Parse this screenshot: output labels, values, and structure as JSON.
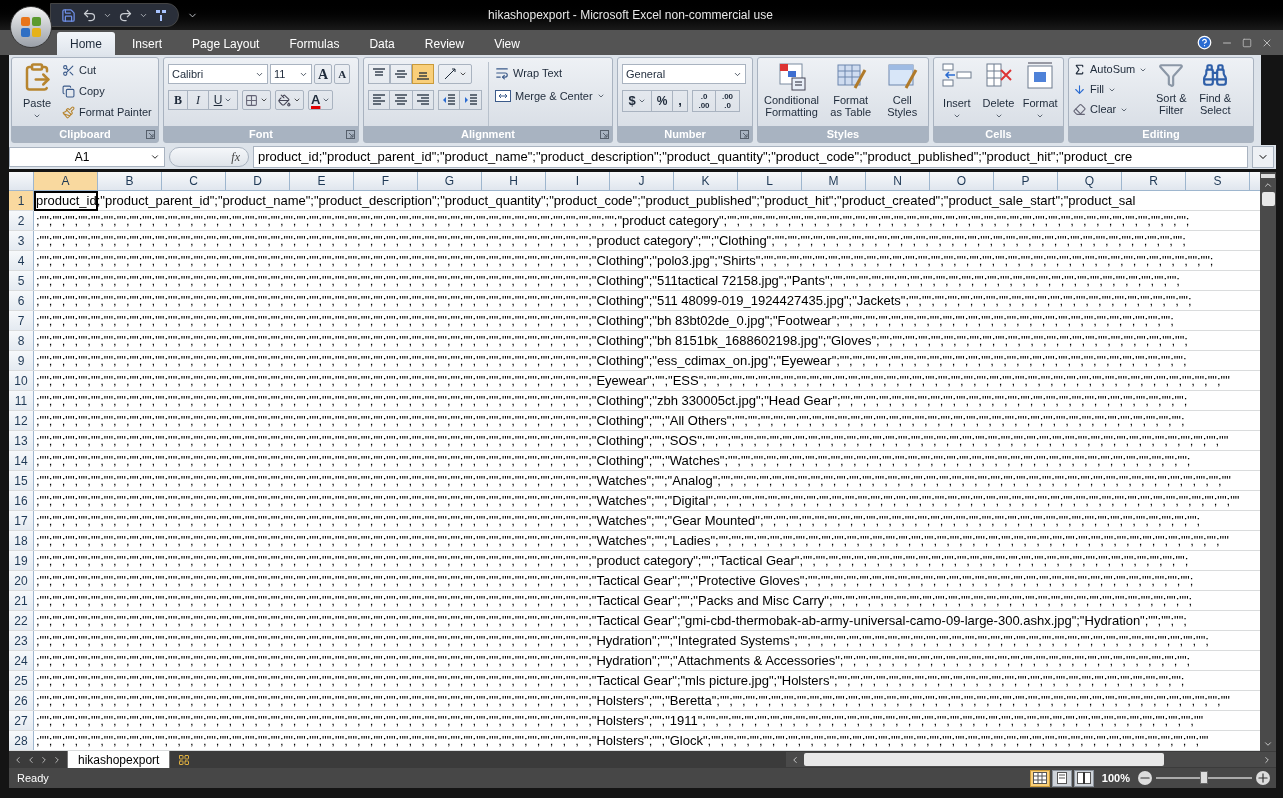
{
  "window": {
    "title": "hikashopexport - Microsoft Excel non-commercial use"
  },
  "tabs": [
    {
      "label": "Home",
      "selected": true
    },
    {
      "label": "Insert",
      "selected": false
    },
    {
      "label": "Page Layout",
      "selected": false
    },
    {
      "label": "Formulas",
      "selected": false
    },
    {
      "label": "Data",
      "selected": false
    },
    {
      "label": "Review",
      "selected": false
    },
    {
      "label": "View",
      "selected": false
    }
  ],
  "ribbon": {
    "clipboard": {
      "label": "Clipboard",
      "paste": "Paste",
      "cut": "Cut",
      "copy": "Copy",
      "format_painter": "Format Painter"
    },
    "font": {
      "label": "Font",
      "font_name": "Calibri",
      "font_size": "11",
      "grow": "A",
      "shrink": "A",
      "bold": "B",
      "italic": "I",
      "underline": "U",
      "font_color": "A"
    },
    "alignment": {
      "label": "Alignment",
      "vertical_align": [
        {
          "kind": "top",
          "selected": false
        },
        {
          "kind": "middle",
          "selected": false
        },
        {
          "kind": "bottom",
          "selected": true
        }
      ],
      "wrap_text": "Wrap Text",
      "merge_center": "Merge & Center"
    },
    "number": {
      "label": "Number",
      "format": "General",
      "currency": "$",
      "percent": "%",
      "comma": ",",
      "increase_decimal": [
        ".0",
        ".00"
      ],
      "decrease_decimal": [
        ".00",
        ".0"
      ]
    },
    "styles": {
      "label": "Styles",
      "items": [
        {
          "kind": "conditional",
          "label": "Conditional Formatting"
        },
        {
          "kind": "table",
          "label": "Format as Table"
        },
        {
          "kind": "cell",
          "label": "Cell Styles"
        }
      ]
    },
    "cells": {
      "label": "Cells",
      "items": [
        {
          "kind": "insert",
          "label": "Insert"
        },
        {
          "kind": "delete",
          "label": "Delete"
        },
        {
          "kind": "format",
          "label": "Format"
        }
      ]
    },
    "editing": {
      "label": "Editing",
      "autosum": "AutoSum",
      "fill": "Fill",
      "clear": "Clear",
      "sort_filter": "Sort & Filter",
      "find_select": "Find & Select"
    }
  },
  "formula_bar": {
    "name_box": "A1",
    "fx": "fx",
    "formula": "product_id;\"product_parent_id\";\"product_name\";\"product_description\";\"product_quantity\";\"product_code\";\"product_published\";\"product_hit\";\"product_cre"
  },
  "sheet": {
    "columns": [
      {
        "label": "A",
        "selected": true
      },
      {
        "label": "B",
        "selected": false
      },
      {
        "label": "C",
        "selected": false
      },
      {
        "label": "D",
        "selected": false
      },
      {
        "label": "E",
        "selected": false
      },
      {
        "label": "F",
        "selected": false
      },
      {
        "label": "G",
        "selected": false
      },
      {
        "label": "H",
        "selected": false
      },
      {
        "label": "I",
        "selected": false
      },
      {
        "label": "J",
        "selected": false
      },
      {
        "label": "K",
        "selected": false
      },
      {
        "label": "L",
        "selected": false
      },
      {
        "label": "M",
        "selected": false
      },
      {
        "label": "N",
        "selected": false
      },
      {
        "label": "O",
        "selected": false
      },
      {
        "label": "P",
        "selected": false
      },
      {
        "label": "Q",
        "selected": false
      },
      {
        "label": "R",
        "selected": false
      },
      {
        "label": "S",
        "selected": false
      }
    ],
    "rows": [
      {
        "number": "1",
        "selected": true,
        "text": "product_id;\"product_parent_id\";\"product_name\";\"product_description\";\"product_quantity\";\"product_code\";\"product_published\";\"product_hit\";\"product_created\";\"product_sale_start\";\"product_sal"
      },
      {
        "number": "2",
        "selected": false,
        "text": ";\"\";\"\";\"\";\"\";\"\";\"\";\"\";\"\";\"\";\"\";\"\";\"\";\"\";\"\";\"\";\"\";\"\";\"\";\"\";\"\";\"\";\"\";\"\";\"\";\"\";\"\";\"\";\"\";\"\";\"\";\"\";\"\";\"\";\"\";\"\";\"\";\"\";\"\";\"\";\"\";\"\";\"\";\"\";\"\";\"\";\"product category\";\"\";\"\";\"\";\"\";\"\";\"\";\"\";\"\";\"\";\"\";\"\";\"\";\"\";\"\";\"\";\"\";\"\";\"\";\"\";\"\";\"\";\"\";\"\";\"\";\"\";\"\";\"\";\"\";\"\";\"\";\"\";\"\";\"\";\"\";\"\";\"\";"
      },
      {
        "number": "3",
        "selected": false,
        "text": ";\"\";\"\";\"\";\"\";\"\";\"\";\"\";\"\";\"\";\"\";\"\";\"\";\"\";\"\";\"\";\"\";\"\";\"\";\"\";\"\";\"\";\"\";\"\";\"\";\"\";\"\";\"\";\"\";\"\";\"\";\"\";\"\";\"\";\"\";\"\";\"\";\"\";\"\";\"\";\"\";\"\";\"\";\"\";\"product category\";\"\";\"Clothing\";\"\";\"\";\"\";\"\";\"\";\"\";\"\";\"\";\"\";\"\";\"\";\"\";\"\";\"\";\"\";\"\";\"\";\"\";\"\";\"\";\"\";\"\";\"\";\"\";\"\";\"\";\"\";\"\";\"\";\"\";\"\";\"\";"
      },
      {
        "number": "4",
        "selected": false,
        "text": ";\"\";\"\";\"\";\"\";\"\";\"\";\"\";\"\";\"\";\"\";\"\";\"\";\"\";\"\";\"\";\"\";\"\";\"\";\"\";\"\";\"\";\"\";\"\";\"\";\"\";\"\";\"\";\"\";\"\";\"\";\"\";\"\";\"\";\"\";\"\";\"\";\"\";\"\";\"\";\"\";\"\";\"\";\"\";\"Clothing\";\"polo3.jpg\";\"Shirts\";\"\";\"\";\"\";\"\";\"\";\"\";\"\";\"\";\"\";\"\";\"\";\"\";\"\";\"\";\"\";\"\";\"\";\"\";\"\";\"\";\"\";\"\";\"\";\"\";\"\";\"\";\"\";\"\";\"\";\"\";\"\";\"\";\"\";\"\";\"\";"
      },
      {
        "number": "5",
        "selected": false,
        "text": ";\"\";\"\";\"\";\"\";\"\";\"\";\"\";\"\";\"\";\"\";\"\";\"\";\"\";\"\";\"\";\"\";\"\";\"\";\"\";\"\";\"\";\"\";\"\";\"\";\"\";\"\";\"\";\"\";\"\";\"\";\"\";\"\";\"\";\"\";\"\";\"\";\"\";\"\";\"\";\"\";\"\";\"\";\"\";\"Clothing\";\"511tactical 72158.jpg\";\"Pants\";\"\";\"\";\"\";\"\";\"\";\"\";\"\";\"\";\"\";\"\";\"\";\"\";\"\";\"\";\"\";\"\";\"\";\"\";\"\";\"\";\"\";\"\";\"\";\"\";\"\";\"\";\"\";"
      },
      {
        "number": "6",
        "selected": false,
        "text": ";\"\";\"\";\"\";\"\";\"\";\"\";\"\";\"\";\"\";\"\";\"\";\"\";\"\";\"\";\"\";\"\";\"\";\"\";\"\";\"\";\"\";\"\";\"\";\"\";\"\";\"\";\"\";\"\";\"\";\"\";\"\";\"\";\"\";\"\";\"\";\"\";\"\";\"\";\"\";\"\";\"\";\"\";\"\";\"Clothing\";\"511 48099-019_1924427435.jpg\";\"Jackets\";\"\";\"\";\"\";\"\";\"\";\"\";\"\";\"\";\"\";\"\";\"\";\"\";\"\";\"\";\"\";\"\";\"\";\"\";\"\";\"\";\"\";\"\";"
      },
      {
        "number": "7",
        "selected": false,
        "text": ";\"\";\"\";\"\";\"\";\"\";\"\";\"\";\"\";\"\";\"\";\"\";\"\";\"\";\"\";\"\";\"\";\"\";\"\";\"\";\"\";\"\";\"\";\"\";\"\";\"\";\"\";\"\";\"\";\"\";\"\";\"\";\"\";\"\";\"\";\"\";\"\";\"\";\"\";\"\";\"\";\"\";\"\";\"\";\"Clothing\";\"bh 83bt02de_0.jpg\";\"Footwear\";\"\";\"\";\"\";\"\";\"\";\"\";\"\";\"\";\"\";\"\";\"\";\"\";\"\";\"\";\"\";\"\";\"\";\"\";\"\";\"\";\"\";\"\";\"\";\"\";\"\";\"\";"
      },
      {
        "number": "8",
        "selected": false,
        "text": ";\"\";\"\";\"\";\"\";\"\";\"\";\"\";\"\";\"\";\"\";\"\";\"\";\"\";\"\";\"\";\"\";\"\";\"\";\"\";\"\";\"\";\"\";\"\";\"\";\"\";\"\";\"\";\"\";\"\";\"\";\"\";\"\";\"\";\"\";\"\";\"\";\"\";\"\";\"\";\"\";\"\";\"\";\"\";\"Clothing\";\"bh 8151bk_1688602198.jpg\";\"Gloves\";\"\";\"\";\"\";\"\";\"\";\"\";\"\";\"\";\"\";\"\";\"\";\"\";\"\";\"\";\"\";\"\";\"\";\"\";\"\";\"\";\"\";\"\";\"\";\"\";"
      },
      {
        "number": "9",
        "selected": false,
        "text": ";\"\";\"\";\"\";\"\";\"\";\"\";\"\";\"\";\"\";\"\";\"\";\"\";\"\";\"\";\"\";\"\";\"\";\"\";\"\";\"\";\"\";\"\";\"\";\"\";\"\";\"\";\"\";\"\";\"\";\"\";\"\";\"\";\"\";\"\";\"\";\"\";\"\";\"\";\"\";\"\";\"\";\"\";\"\";\"Clothing\";\"ess_cdimax_on.jpg\";\"Eyewear\";\"\";\"\";\"\";\"\";\"\";\"\";\"\";\"\";\"\";\"\";\"\";\"\";\"\";\"\";\"\";\"\";\"\";\"\";\"\";\"\";\"\";\"\";\"\";\"\";\"\";\"\";\"\";"
      },
      {
        "number": "10",
        "selected": false,
        "text": ";\"\";\"\";\"\";\"\";\"\";\"\";\"\";\"\";\"\";\"\";\"\";\"\";\"\";\"\";\"\";\"\";\"\";\"\";\"\";\"\";\"\";\"\";\"\";\"\";\"\";\"\";\"\";\"\";\"\";\"\";\"\";\"\";\"\";\"\";\"\";\"\";\"\";\"\";\"\";\"\";\"\";\"\";\"\";\"Eyewear\";\"\";\"ESS\";\"\";\"\";\"\";\"\";\"\";\"\";\"\";\"\";\"\";\"\";\"\";\"\";\"\";\"\";\"\";\"\";\"\";\"\";\"\";\"\";\"\";\"\";\"\";\"\";\"\";\"\";\"\";\"\";\"\";\"\";\"\";\"\";\"\";\"\";\"\";\"\";\"\";\"\";\"\";\"\";\"\""
      },
      {
        "number": "11",
        "selected": false,
        "text": ";\"\";\"\";\"\";\"\";\"\";\"\";\"\";\"\";\"\";\"\";\"\";\"\";\"\";\"\";\"\";\"\";\"\";\"\";\"\";\"\";\"\";\"\";\"\";\"\";\"\";\"\";\"\";\"\";\"\";\"\";\"\";\"\";\"\";\"\";\"\";\"\";\"\";\"\";\"\";\"\";\"\";\"\";\"\";\"Clothing\";\"zbh 330005ct.jpg\";\"Head Gear\";\"\";\"\";\"\";\"\";\"\";\"\";\"\";\"\";\"\";\"\";\"\";\"\";\"\";\"\";\"\";\"\";\"\";\"\";\"\";\"\";\"\";\"\";\"\";\"\";\"\";\"\";\"\";"
      },
      {
        "number": "12",
        "selected": false,
        "text": ";\"\";\"\";\"\";\"\";\"\";\"\";\"\";\"\";\"\";\"\";\"\";\"\";\"\";\"\";\"\";\"\";\"\";\"\";\"\";\"\";\"\";\"\";\"\";\"\";\"\";\"\";\"\";\"\";\"\";\"\";\"\";\"\";\"\";\"\";\"\";\"\";\"\";\"\";\"\";\"\";\"\";\"\";\"\";\"Clothing\";\"\";\"All Others\";\"\";\"\";\"\";\"\";\"\";\"\";\"\";\"\";\"\";\"\";\"\";\"\";\"\";\"\";\"\";\"\";\"\";\"\";\"\";\"\";\"\";\"\";\"\";\"\";\"\";\"\";\"\";\"\";\"\";\"\";\"\";\"\";\"\";\"\";\"\";"
      },
      {
        "number": "13",
        "selected": false,
        "text": ";\"\";\"\";\"\";\"\";\"\";\"\";\"\";\"\";\"\";\"\";\"\";\"\";\"\";\"\";\"\";\"\";\"\";\"\";\"\";\"\";\"\";\"\";\"\";\"\";\"\";\"\";\"\";\"\";\"\";\"\";\"\";\"\";\"\";\"\";\"\";\"\";\"\";\"\";\"\";\"\";\"\";\"\";\"\";\"Clothing\";\"\";\"SOS\";\"\";\"\";\"\";\"\";\"\";\"\";\"\";\"\";\"\";\"\";\"\";\"\";\"\";\"\";\"\";\"\";\"\";\"\";\"\";\"\";\"\";\"\";\"\";\"\";\"\";\"\";\"\";\"\";\"\";\"\";\"\";\"\";\"\";\"\";\"\";\"\";\"\";\"\";\"\";\"\";\"\""
      },
      {
        "number": "14",
        "selected": false,
        "text": ";\"\";\"\";\"\";\"\";\"\";\"\";\"\";\"\";\"\";\"\";\"\";\"\";\"\";\"\";\"\";\"\";\"\";\"\";\"\";\"\";\"\";\"\";\"\";\"\";\"\";\"\";\"\";\"\";\"\";\"\";\"\";\"\";\"\";\"\";\"\";\"\";\"\";\"\";\"\";\"\";\"\";\"\";\"\";\"Clothing\";\"\";\"Watches\";\"\";\"\";\"\";\"\";\"\";\"\";\"\";\"\";\"\";\"\";\"\";\"\";\"\";\"\";\"\";\"\";\"\";\"\";\"\";\"\";\"\";\"\";\"\";\"\";\"\";\"\";\"\";\"\";\"\";\"\";\"\";\"\";\"\";\"\";\"\";\"\";"
      },
      {
        "number": "15",
        "selected": false,
        "text": ";\"\";\"\";\"\";\"\";\"\";\"\";\"\";\"\";\"\";\"\";\"\";\"\";\"\";\"\";\"\";\"\";\"\";\"\";\"\";\"\";\"\";\"\";\"\";\"\";\"\";\"\";\"\";\"\";\"\";\"\";\"\";\"\";\"\";\"\";\"\";\"\";\"\";\"\";\"\";\"\";\"\";\"\";\"\";\"Watches\";\"\";\"Analog\";\"\";\"\";\"\";\"\";\"\";\"\";\"\";\"\";\"\";\"\";\"\";\"\";\"\";\"\";\"\";\"\";\"\";\"\";\"\";\"\";\"\";\"\";\"\";\"\";\"\";\"\";\"\";\"\";\"\";\"\";\"\";\"\";\"\";\"\";\"\";\"\";\"\";\"\";\"\";\"\""
      },
      {
        "number": "16",
        "selected": false,
        "text": ";\"\";\"\";\"\";\"\";\"\";\"\";\"\";\"\";\"\";\"\";\"\";\"\";\"\";\"\";\"\";\"\";\"\";\"\";\"\";\"\";\"\";\"\";\"\";\"\";\"\";\"\";\"\";\"\";\"\";\"\";\"\";\"\";\"\";\"\";\"\";\"\";\"\";\"\";\"\";\"\";\"\";\"\";\"\";\"Watches\";\"\";\"Digital\";\"\";\"\";\"\";\"\";\"\";\"\";\"\";\"\";\"\";\"\";\"\";\"\";\"\";\"\";\"\";\"\";\"\";\"\";\"\";\"\";\"\";\"\";\"\";\"\";\"\";\"\";\"\";\"\";\"\";\"\";\"\";\"\";\"\";\"\";\"\";\"\";\"\";\"\";\"\";\"\";\"\""
      },
      {
        "number": "17",
        "selected": false,
        "text": ";\"\";\"\";\"\";\"\";\"\";\"\";\"\";\"\";\"\";\"\";\"\";\"\";\"\";\"\";\"\";\"\";\"\";\"\";\"\";\"\";\"\";\"\";\"\";\"\";\"\";\"\";\"\";\"\";\"\";\"\";\"\";\"\";\"\";\"\";\"\";\"\";\"\";\"\";\"\";\"\";\"\";\"\";\"\";\"Watches\";\"\";\"Gear Mounted\";\"\";\"\";\"\";\"\";\"\";\"\";\"\";\"\";\"\";\"\";\"\";\"\";\"\";\"\";\"\";\"\";\"\";\"\";\"\";\"\";\"\";\"\";\"\";\"\";\"\";\"\";\"\";\"\";\"\";\"\";\"\";\"\";\"\";\"\";"
      },
      {
        "number": "18",
        "selected": false,
        "text": ";\"\";\"\";\"\";\"\";\"\";\"\";\"\";\"\";\"\";\"\";\"\";\"\";\"\";\"\";\"\";\"\";\"\";\"\";\"\";\"\";\"\";\"\";\"\";\"\";\"\";\"\";\"\";\"\";\"\";\"\";\"\";\"\";\"\";\"\";\"\";\"\";\"\";\"\";\"\";\"\";\"\";\"\";\"\";\"Watches\";\"\";\"Ladies\";\"\";\"\";\"\";\"\";\"\";\"\";\"\";\"\";\"\";\"\";\"\";\"\";\"\";\"\";\"\";\"\";\"\";\"\";\"\";\"\";\"\";\"\";\"\";\"\";\"\";\"\";\"\";\"\";\"\";\"\";\"\";\"\";\"\";\"\";\"\";\"\";\"\";\"\";\"\";\"\""
      },
      {
        "number": "19",
        "selected": false,
        "text": ";\"\";\"\";\"\";\"\";\"\";\"\";\"\";\"\";\"\";\"\";\"\";\"\";\"\";\"\";\"\";\"\";\"\";\"\";\"\";\"\";\"\";\"\";\"\";\"\";\"\";\"\";\"\";\"\";\"\";\"\";\"\";\"\";\"\";\"\";\"\";\"\";\"\";\"\";\"\";\"\";\"\";\"\";\"\";\"product category\";\"\";\"Tactical Gear\";\"\";\"\";\"\";\"\";\"\";\"\";\"\";\"\";\"\";\"\";\"\";\"\";\"\";\"\";\"\";\"\";\"\";\"\";\"\";\"\";\"\";\"\";\"\";\"\";\"\";\"\";\"\";\"\";\"\";\"\";"
      },
      {
        "number": "20",
        "selected": false,
        "text": ";\"\";\"\";\"\";\"\";\"\";\"\";\"\";\"\";\"\";\"\";\"\";\"\";\"\";\"\";\"\";\"\";\"\";\"\";\"\";\"\";\"\";\"\";\"\";\"\";\"\";\"\";\"\";\"\";\"\";\"\";\"\";\"\";\"\";\"\";\"\";\"\";\"\";\"\";\"\";\"\";\"\";\"\";\"\";\"Tactical Gear\";\"\";\"Protective Gloves\";\"\";\"\";\"\";\"\";\"\";\"\";\"\";\"\";\"\";\"\";\"\";\"\";\"\";\"\";\"\";\"\";\"\";\"\";\"\";\"\";\"\";\"\";\"\";\"\";\"\";\"\";\"\";\"\";\"\";\"\";"
      },
      {
        "number": "21",
        "selected": false,
        "text": ";\"\";\"\";\"\";\"\";\"\";\"\";\"\";\"\";\"\";\"\";\"\";\"\";\"\";\"\";\"\";\"\";\"\";\"\";\"\";\"\";\"\";\"\";\"\";\"\";\"\";\"\";\"\";\"\";\"\";\"\";\"\";\"\";\"\";\"\";\"\";\"\";\"\";\"\";\"\";\"\";\"\";\"\";\"\";\"Tactical Gear\";\"\";\"Packs and Misc Carry\";\"\";\"\";\"\";\"\";\"\";\"\";\"\";\"\";\"\";\"\";\"\";\"\";\"\";\"\";\"\";\"\";\"\";\"\";\"\";\"\";\"\";\"\";\"\";\"\";\"\";\"\";\"\";\"\";"
      },
      {
        "number": "22",
        "selected": false,
        "text": ";\"\";\"\";\"\";\"\";\"\";\"\";\"\";\"\";\"\";\"\";\"\";\"\";\"\";\"\";\"\";\"\";\"\";\"\";\"\";\"\";\"\";\"\";\"\";\"\";\"\";\"\";\"\";\"\";\"\";\"\";\"\";\"\";\"\";\"\";\"\";\"\";\"\";\"\";\"\";\"\";\"\";\"\";\"\";\"Tactical Gear\";\"gmi-cbd-thermobak-ab-army-universal-camo-09-large-300.ashx.jpg\";\"Hydration\";\"\";\"\";\"\";"
      },
      {
        "number": "23",
        "selected": false,
        "text": ";\"\";\"\";\"\";\"\";\"\";\"\";\"\";\"\";\"\";\"\";\"\";\"\";\"\";\"\";\"\";\"\";\"\";\"\";\"\";\"\";\"\";\"\";\"\";\"\";\"\";\"\";\"\";\"\";\"\";\"\";\"\";\"\";\"\";\"\";\"\";\"\";\"\";\"\";\"\";\"\";\"\";\"\";\"\";\"Hydration\";\"\";\"Integrated Systems\";\"\";\"\";\"\";\"\";\"\";\"\";\"\";\"\";\"\";\"\";\"\";\"\";\"\";\"\";\"\";\"\";\"\";\"\";\"\";\"\";\"\";\"\";\"\";\"\";\"\";\"\";\"\";\"\";\"\";\"\";\"\";\"\";"
      },
      {
        "number": "24",
        "selected": false,
        "text": ";\"\";\"\";\"\";\"\";\"\";\"\";\"\";\"\";\"\";\"\";\"\";\"\";\"\";\"\";\"\";\"\";\"\";\"\";\"\";\"\";\"\";\"\";\"\";\"\";\"\";\"\";\"\";\"\";\"\";\"\";\"\";\"\";\"\";\"\";\"\";\"\";\"\";\"\";\"\";\"\";\"\";\"\";\"\";\"Hydration\";\"\";\"Attachments & Accessories\";\"\";\"\";\"\";\"\";\"\";\"\";\"\";\"\";\"\";\"\";\"\";\"\";\"\";\"\";\"\";\"\";\"\";\"\";\"\";\"\";\"\";\"\";\"\";\"\";\"\";\"\";\"\";"
      },
      {
        "number": "25",
        "selected": false,
        "text": ";\"\";\"\";\"\";\"\";\"\";\"\";\"\";\"\";\"\";\"\";\"\";\"\";\"\";\"\";\"\";\"\";\"\";\"\";\"\";\"\";\"\";\"\";\"\";\"\";\"\";\"\";\"\";\"\";\"\";\"\";\"\";\"\";\"\";\"\";\"\";\"\";\"\";\"\";\"\";\"\";\"\";\"\";\"\";\"Tactical Gear\";\"mls picture.jpg\";\"Holsters\";\"\";\"\";\"\";\"\";\"\";\"\";\"\";\"\";\"\";\"\";\"\";\"\";\"\";\"\";\"\";\"\";\"\";\"\";\"\";\"\";\"\";\"\";\"\";\"\";\"\";\"\";\"\";"
      },
      {
        "number": "26",
        "selected": false,
        "text": ";\"\";\"\";\"\";\"\";\"\";\"\";\"\";\"\";\"\";\"\";\"\";\"\";\"\";\"\";\"\";\"\";\"\";\"\";\"\";\"\";\"\";\"\";\"\";\"\";\"\";\"\";\"\";\"\";\"\";\"\";\"\";\"\";\"\";\"\";\"\";\"\";\"\";\"\";\"\";\"\";\"\";\"\";\"\";\"Holsters\";\"\";\"Beretta\";\"\";\"\";\"\";\"\";\"\";\"\";\"\";\"\";\"\";\"\";\"\";\"\";\"\";\"\";\"\";\"\";\"\";\"\";\"\";\"\";\"\";\"\";\"\";\"\";\"\";\"\";\"\";\"\";\"\";\"\";\"\";\"\";\"\";\"\";\"\";\"\";\"\";\"\";\"\";\"\""
      },
      {
        "number": "27",
        "selected": false,
        "text": ";\"\";\"\";\"\";\"\";\"\";\"\";\"\";\"\";\"\";\"\";\"\";\"\";\"\";\"\";\"\";\"\";\"\";\"\";\"\";\"\";\"\";\"\";\"\";\"\";\"\";\"\";\"\";\"\";\"\";\"\";\"\";\"\";\"\";\"\";\"\";\"\";\"\";\"\";\"\";\"\";\"\";\"\";\"\";\"Holsters\";\"\";\"1911\";\"\";\"\";\"\";\"\";\"\";\"\";\"\";\"\";\"\";\"\";\"\";\"\";\"\";\"\";\"\";\"\";\"\";\"\";\"\";\"\";\"\";\"\";\"\";\"\";\"\";\"\";\"\";\"\";\"\";\"\";\"\";\"\";\"\";\"\";\"\";\"\";\"\";\"\";\"\""
      },
      {
        "number": "28",
        "selected": false,
        "text": ";\"\";\"\";\"\";\"\";\"\";\"\";\"\";\"\";\"\";\"\";\"\";\"\";\"\";\"\";\"\";\"\";\"\";\"\";\"\";\"\";\"\";\"\";\"\";\"\";\"\";\"\";\"\";\"\";\"\";\"\";\"\";\"\";\"\";\"\";\"\";\"\";\"\";\"\";\"\";\"\";\"\";\"\";\"\";\"Holsters\";\"\";\"Glock\";\"\";\"\";\"\";\"\";\"\";\"\";\"\";\"\";\"\";\"\";\"\";\"\";\"\";\"\";\"\";\"\";\"\";\"\";\"\";\"\";\"\";\"\";\"\";\"\";\"\";\"\";\"\";\"\";\"\";\"\";\"\";\"\";\"\";\"\";\"\";\"\";\"\";\"\";\"\""
      }
    ]
  },
  "sheet_tabs": [
    {
      "label": "hikashopexport",
      "selected": true
    }
  ],
  "status_bar": {
    "status": "Ready",
    "views": [
      {
        "kind": "normal",
        "selected": true
      },
      {
        "kind": "page_layout",
        "selected": false
      },
      {
        "kind": "page_break",
        "selected": false
      }
    ],
    "zoom": "100%",
    "zoom_slider": {
      "level": 0.5
    }
  }
}
